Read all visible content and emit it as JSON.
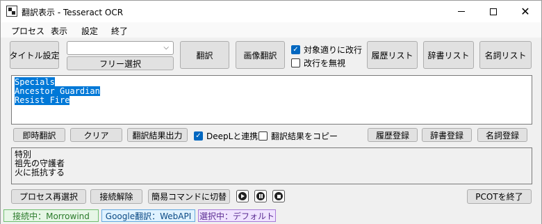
{
  "window": {
    "title": "翻訳表示 - Tesseract OCR",
    "minimize": "—",
    "maximize": "□",
    "close": "✕"
  },
  "menu": [
    "プロセス",
    "表示",
    "設定",
    "終了"
  ],
  "toolbar": {
    "title_settings": "タイトル設定",
    "combo_value": "",
    "free_select": "フリー選択",
    "translate": "翻訳",
    "image_translate": "画像翻訳",
    "wrap_period_label": "対象適りに改行",
    "wrap_period_checked": true,
    "ignore_newline_label": "改行を無視",
    "ignore_newline_checked": false,
    "history_list": "履歴リスト",
    "dictionary_list": "辞書リスト",
    "noun_list": "名詞リスト"
  },
  "source_text": [
    "Specials",
    "Ancestor Guardian",
    "Resist Fire"
  ],
  "actions": {
    "instant_translate": "即時翻訳",
    "clear": "クリア",
    "export_result": "翻訳結果出力",
    "deepl_label": "DeepLと連携",
    "deepl_checked": true,
    "copy_result_label": "翻訳結果をコピー",
    "copy_result_checked": false,
    "history_register": "履歴登録",
    "dictionary_register": "辞書登録",
    "noun_register": "名詞登録"
  },
  "translated_text": [
    "特別",
    "祖先の守護者",
    "火に抵抗する"
  ],
  "bottom": {
    "reselect_process": "プロセス再選択",
    "disconnect": "接続解除",
    "simple_command": "簡易コマンドに切替",
    "pcot_quit": "PCOTを終了"
  },
  "status": {
    "connection": "接続中：Morrowind",
    "translator": "Google翻訳：WebAPI",
    "selection": "選択中：デフォルト"
  },
  "colors": {
    "status_connection_bg": "#e6f6e6",
    "status_connection_border": "#6fbf6f",
    "status_connection_text": "#2a7a2a",
    "status_translator_bg": "#dff2ff",
    "status_translator_border": "#63a9e0",
    "status_translator_text": "#0b4a85",
    "status_selection_bg": "#efe3ff",
    "status_selection_border": "#a77ad8",
    "status_selection_text": "#5a2b91",
    "selection_highlight": "#0078d7"
  }
}
